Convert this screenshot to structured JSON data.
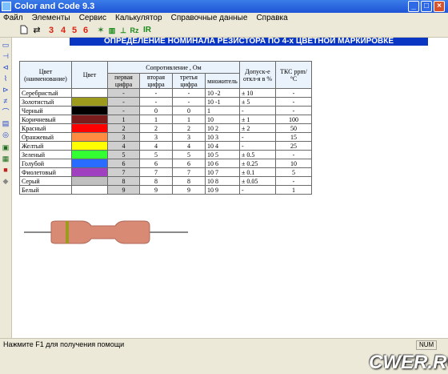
{
  "window": {
    "title": "Color and Code 9.3"
  },
  "menu": [
    "Файл",
    "Элементы",
    "Сервис",
    "Калькулятор",
    "Справочные данные",
    "Справка"
  ],
  "toolbar": {
    "n3": "3",
    "n4": "4",
    "n5": "5",
    "n6": "6",
    "rz": "Rz",
    "ir": "IR"
  },
  "header": {
    "title": "ОПРЕДЕЛЕНИЕ НОМИНАЛА РЕЗИСТОРА ПО 4-х ЦВЕТНОЙ МАРКИРОВКЕ"
  },
  "table": {
    "h_name": "Цвет (наименование)",
    "h_color": "Цвет",
    "h_resistance": "Сопротивление , Ом",
    "h_tolerance": "Допуск-е откл-я в %",
    "h_tks": "ТКС ppm/°C",
    "h_d1": "первая цифра",
    "h_d2": "вторая цифра",
    "h_d3": "третья цифра",
    "h_mult": "множитель",
    "rows": [
      {
        "name": "Серебристый",
        "swatch": "#ffffff",
        "d1": "-",
        "d2": "-",
        "d3": "-",
        "mult": "10 -2",
        "tol": "± 10",
        "tks": "-"
      },
      {
        "name": "Золотистый",
        "swatch": "#9c9b1e",
        "d1": "-",
        "d2": "-",
        "d3": "-",
        "mult": "10 -1",
        "tol": "± 5",
        "tks": "-"
      },
      {
        "name": "Черный",
        "swatch": "#000000",
        "d1": "-",
        "d2": "0",
        "d3": "0",
        "mult": "1",
        "tol": "-",
        "tks": "-"
      },
      {
        "name": "Коричневый",
        "swatch": "#7a1c1c",
        "d1": "1",
        "d2": "1",
        "d3": "1",
        "mult": "10",
        "tol": "± 1",
        "tks": "100"
      },
      {
        "name": "Красный",
        "swatch": "#ff0000",
        "d1": "2",
        "d2": "2",
        "d3": "2",
        "mult": "10 2",
        "tol": "± 2",
        "tks": "50"
      },
      {
        "name": "Оранжевый",
        "swatch": "#ff8c40",
        "d1": "3",
        "d2": "3",
        "d3": "3",
        "mult": "10 3",
        "tol": "-",
        "tks": "15"
      },
      {
        "name": "Желтый",
        "swatch": "#ffff00",
        "d1": "4",
        "d2": "4",
        "d3": "4",
        "mult": "10 4",
        "tol": "-",
        "tks": "25"
      },
      {
        "name": "Зеленый",
        "swatch": "#33ff33",
        "d1": "5",
        "d2": "5",
        "d3": "5",
        "mult": "10 5",
        "tol": "± 0.5",
        "tks": "-"
      },
      {
        "name": "Голубой",
        "swatch": "#2a6cff",
        "d1": "6",
        "d2": "6",
        "d3": "6",
        "mult": "10 6",
        "tol": "± 0.25",
        "tks": "10"
      },
      {
        "name": "Фиолетовый",
        "swatch": "#a040c0",
        "d1": "7",
        "d2": "7",
        "d3": "7",
        "mult": "10 7",
        "tol": "± 0.1",
        "tks": "5"
      },
      {
        "name": "Серый",
        "swatch": "#c0c0c0",
        "d1": "8",
        "d2": "8",
        "d3": "8",
        "mult": "10 8",
        "tol": "± 0.05",
        "tks": "-"
      },
      {
        "name": "Белый",
        "swatch": "#ffffff",
        "d1": "9",
        "d2": "9",
        "d3": "9",
        "mult": "10 9",
        "tol": "-",
        "tks": "1"
      }
    ]
  },
  "status": {
    "text": "Нажмите F1 для получения помощи",
    "num": "NUM"
  },
  "watermark": "CWER.RU"
}
